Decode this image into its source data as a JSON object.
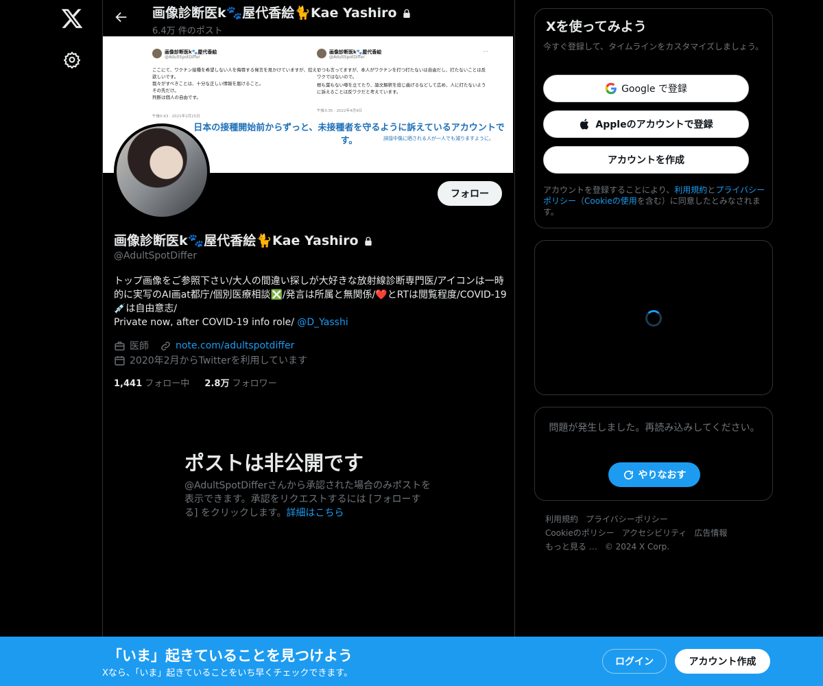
{
  "nav": {
    "logo_icon": "x-logo-icon",
    "settings_icon": "gear-icon"
  },
  "header": {
    "name": "画像診断医k🐾屋代香絵🐈Kae Yashiro",
    "post_count": "6.4万 件のポスト"
  },
  "banner": {
    "tweets": [
      {
        "name": "画像診断医k🐾屋代香絵",
        "handle": "@AdultSpotDiffer",
        "lines": [
          "ここにて、ワクチン接種を希望しない人を侮辱する発言を見かけていますが、控えて欲しいです。",
          "我々がすべきことは、十分な正しい情報を届けること。",
          "その先だけ。",
          "判断は個人の自由です。"
        ],
        "time": "午後0:43 · 2021年2月15日"
      },
      {
        "name": "画像診断医k🐾屋代香絵",
        "handle": "@AdultSpotDiffer",
        "lines": [
          "いつも言ってますが、本人がワクチンを打つ打たないは自由だし、打たないことは反ワクではないので。",
          "根も葉もない噂を立てたり、論文解釈を捻じ曲げるなどして広め、人に打たないように訴えることは反ワクだと考えています。"
        ],
        "time": "午後3:35 · 2022年4月9日"
      }
    ],
    "headline": "日本の接種開始前からずっと、未接種者を守るように訴えているアカウントです。",
    "subline": "誹謗中傷に晒される人が一人でも減りますように。"
  },
  "profile": {
    "follow_label": "フォロー",
    "name": "画像診断医k🐾屋代香絵🐈Kae Yashiro",
    "handle": "@AdultSpotDiffer",
    "bio_text": "トップ画像をご参照下さい/大人の間違い探しが大好きな放射線診断専門医/アイコンは一時的に実写のAI画at都庁/個別医療相談❎/発言は所属と無関係/❤️とRTは閲覧程度/COVID-19 💉は自由意志/",
    "bio_line2": "Private now, after COVID-19 info role/ ",
    "bio_mention": "@D_Yasshi",
    "job": "医師",
    "website": "note.com/adultspotdiffer",
    "joined": "2020年2月からTwitterを利用しています",
    "following_count": "1,441",
    "following_label": "フォロー中",
    "followers_count": "2.8万",
    "followers_label": "フォロワー"
  },
  "private_notice": {
    "title": "ポストは非公開です",
    "desc": "@AdultSpotDifferさんから承認された場合のみポストを表示できます。承認をリクエストするには [フォローする] をクリックします。",
    "link": "詳細はこちら"
  },
  "signup": {
    "title": "Xを使ってみよう",
    "subtitle": "今すぐ登録して、タイムラインをカスタマイズしましょう。",
    "google_label": "Google で登録",
    "apple_label": "Appleのアカウントで登録",
    "create_label": "アカウントを作成",
    "legal_pre": "アカウントを登録することにより、",
    "legal_terms": "利用規約",
    "legal_and": "と",
    "legal_privacy": "プライバシーポリシー",
    "legal_mid": "（",
    "legal_cookie": "Cookieの使用",
    "legal_post": "を含む）に同意したとみなされます。"
  },
  "error_card": {
    "message": "問題が発生しました。再読み込みしてください。",
    "retry_label": "やりなおす"
  },
  "footer": {
    "links": [
      "利用規約",
      "プライバシーポリシー",
      "Cookieのポリシー",
      "アクセシビリティ",
      "広告情報",
      "もっと見る …",
      "© 2024 X Corp."
    ]
  },
  "bottom_bar": {
    "title": "「いま」起きていることを見つけよう",
    "subtitle": "Xなら、「いま」起きていることをいち早くチェックできます。",
    "login_label": "ログイン",
    "signup_label": "アカウント作成"
  },
  "colors": {
    "accent": "#1d9bf0",
    "background": "#000000",
    "muted": "#71767b",
    "border": "#2f3336"
  }
}
